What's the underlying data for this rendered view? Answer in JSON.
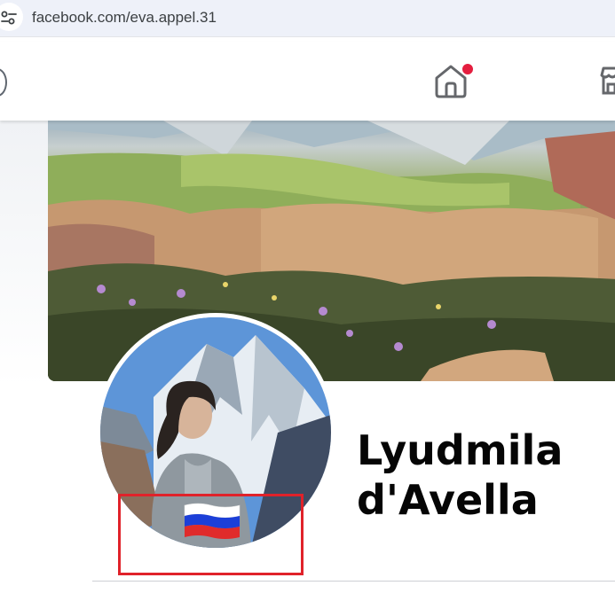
{
  "browser": {
    "url": "facebook.com/eva.appel.31",
    "site_info_icon": "tune-icon"
  },
  "nav": {
    "home_icon": "home-icon",
    "notification_dot_color": "#e41e3f",
    "marketplace_icon": "marketplace-icon"
  },
  "profile": {
    "name_line1": "Lyudmila",
    "name_line2": "d'Avella",
    "flag_badge": "russia-flag-icon",
    "highlight_color": "#e0222a"
  },
  "colors": {
    "name_text": "#050505",
    "address_bar": "#eef1f9"
  }
}
